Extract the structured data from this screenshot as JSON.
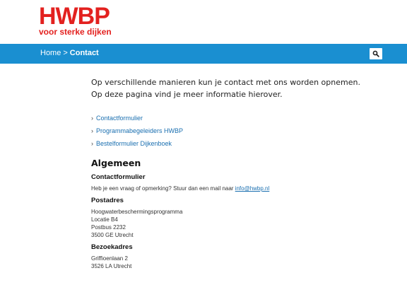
{
  "brand": {
    "logo_text": "HWBP",
    "tagline": "voor sterke dijken",
    "color": "#e3211f"
  },
  "nav": {
    "background": "#1a8fd1",
    "breadcrumb": {
      "home": "Home",
      "separator": ">",
      "current": "Contact"
    },
    "search_icon": "search-icon"
  },
  "intro": {
    "line1": "Op verschillende manieren kun je contact met ons worden opnemen.",
    "line2": "Op deze pagina vind je meer informatie hierover."
  },
  "links": [
    {
      "label": "Contactformulier"
    },
    {
      "label": "Programmabegeleiders HWBP"
    },
    {
      "label": "Bestelformulier Dijkenboek"
    }
  ],
  "section": {
    "title": "Algemeen",
    "contactform": {
      "heading": "Contactformulier",
      "text": "Heb je een vraag of opmerking? Stuur dan een mail naar ",
      "email": "info@hwbp.nl"
    },
    "postadres": {
      "heading": "Postadres",
      "lines": [
        "Hoogwaterbeschermingsprogramma",
        "Locatie B4",
        "Postbus 2232",
        "3500 GE  Utrecht"
      ]
    },
    "bezoekadres": {
      "heading": "Bezoekadres",
      "lines": [
        "Griffioenlaan 2",
        "3526 LA  Utrecht"
      ]
    }
  }
}
